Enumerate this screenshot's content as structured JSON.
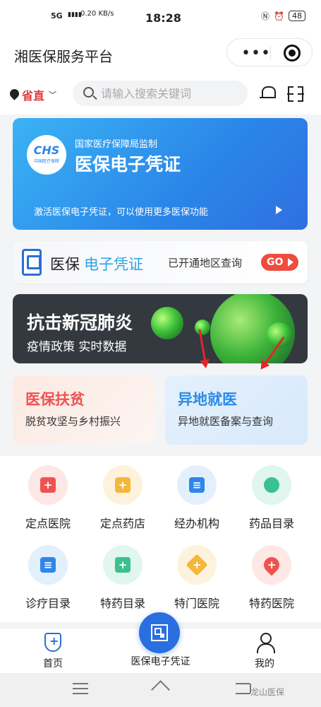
{
  "status_bar": {
    "time": "18:28",
    "network": "5G",
    "speed": "0.20 KB/s",
    "battery": "48"
  },
  "header": {
    "title": "湘医保服务平台"
  },
  "search": {
    "location": "省直",
    "placeholder": "请输入搜索关键词"
  },
  "cert_card": {
    "logo_text": "CHS",
    "logo_sub": "中国医疗保障",
    "supervised_by": "国家医疗保障局监制",
    "title": "医保电子凭证",
    "description": "激活医保电子凭证，可以使用更多医保功能"
  },
  "ecert_bar": {
    "title_part1": "医保",
    "title_part2": "电子凭证",
    "query_label": "已开通地区查询",
    "go_label": "GO"
  },
  "banner": {
    "headline": "抗击新冠肺炎",
    "subline": "疫情政策  实时数据"
  },
  "tiles": [
    {
      "title": "医保扶贫",
      "subtitle": "脱贫攻坚与乡村振兴"
    },
    {
      "title": "异地就医",
      "subtitle": "异地就医备案与查询"
    }
  ],
  "services": [
    {
      "label": "定点医院",
      "icon": "hospital-icon",
      "color": "#ef5350",
      "bg": "#fde8e6"
    },
    {
      "label": "定点药店",
      "icon": "pharmacy-icon",
      "color": "#f4b73a",
      "bg": "#fdf3dd"
    },
    {
      "label": "经办机构",
      "icon": "building-icon",
      "color": "#2f86e8",
      "bg": "#e3effd"
    },
    {
      "label": "药品目录",
      "icon": "pill-icon",
      "color": "#39c190",
      "bg": "#e0f6ee"
    },
    {
      "label": "诊疗目录",
      "icon": "clipboard-icon",
      "color": "#2f86e8",
      "bg": "#e3effd"
    },
    {
      "label": "特药目录",
      "icon": "medkit-icon",
      "color": "#39c190",
      "bg": "#e0f6ee"
    },
    {
      "label": "特门医院",
      "icon": "clinic-icon",
      "color": "#f4b73a",
      "bg": "#fdf3dd"
    },
    {
      "label": "特药医院",
      "icon": "location-pin-icon",
      "color": "#ef5350",
      "bg": "#fde8e6"
    }
  ],
  "tabs": [
    {
      "label": "首页"
    },
    {
      "label": "医保电子凭证"
    },
    {
      "label": "我的"
    }
  ],
  "watermark": "龙山医保"
}
